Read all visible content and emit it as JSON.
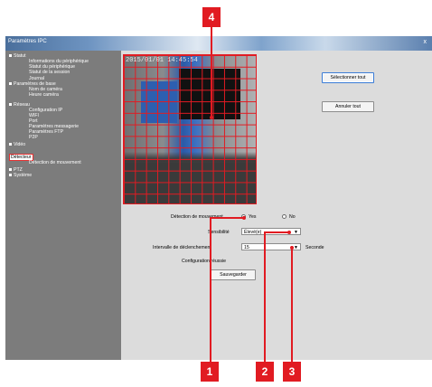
{
  "window": {
    "title": "Paramètres IPC",
    "close_glyph": "x"
  },
  "sidebar": {
    "items": [
      {
        "label": "Statut",
        "level": 0
      },
      {
        "label": "Informations du périphérique",
        "level": 1
      },
      {
        "label": "Statut du périphérique",
        "level": 1
      },
      {
        "label": "Statut de la session",
        "level": 1
      },
      {
        "label": "Journal",
        "level": 1
      },
      {
        "label": "Paramètres de base",
        "level": 0
      },
      {
        "label": "Nom de caméra",
        "level": 1
      },
      {
        "label": "Heure caméra",
        "level": 1
      },
      {
        "label": "Réseau",
        "level": 0
      },
      {
        "label": "Configuration IP",
        "level": 1
      },
      {
        "label": "WIFI",
        "level": 1
      },
      {
        "label": "Port",
        "level": 1
      },
      {
        "label": "Paramètres messagerie",
        "level": 1
      },
      {
        "label": "Paramètres FTP",
        "level": 1
      },
      {
        "label": "P2P",
        "level": 1
      },
      {
        "label": "Vidéo",
        "level": 0
      },
      {
        "label": "Détecteur",
        "level": 0
      },
      {
        "label": "Détection de mouvement",
        "level": 1
      },
      {
        "label": "PTZ",
        "level": 0
      },
      {
        "label": "Système",
        "level": 0
      }
    ]
  },
  "video": {
    "timestamp": "2015/01/01 14:45:54"
  },
  "buttons": {
    "select_all": "Sélectionner tout",
    "cancel_all": "Annuler tout",
    "save": "Sauvegarder"
  },
  "form": {
    "motion_detection_label": "Détection de mouvement",
    "yes_label": "Yes",
    "no_label": "No",
    "motion_detection_value": "Yes",
    "sensitivity_label": "Sensibilité",
    "sensitivity_value": "Élevé(e)",
    "trigger_interval_label": "Intervalle de déclenchement",
    "trigger_interval_value": "15",
    "seconds_label": "Seconde",
    "status_text": "Configuration réussie"
  },
  "callouts": {
    "c1": "1",
    "c2": "2",
    "c3": "3",
    "c4": "4"
  },
  "colors": {
    "callout_red": "#e11b22",
    "sidebar_gray": "#7c7c7c",
    "panel_gray": "#dcdcdc"
  }
}
